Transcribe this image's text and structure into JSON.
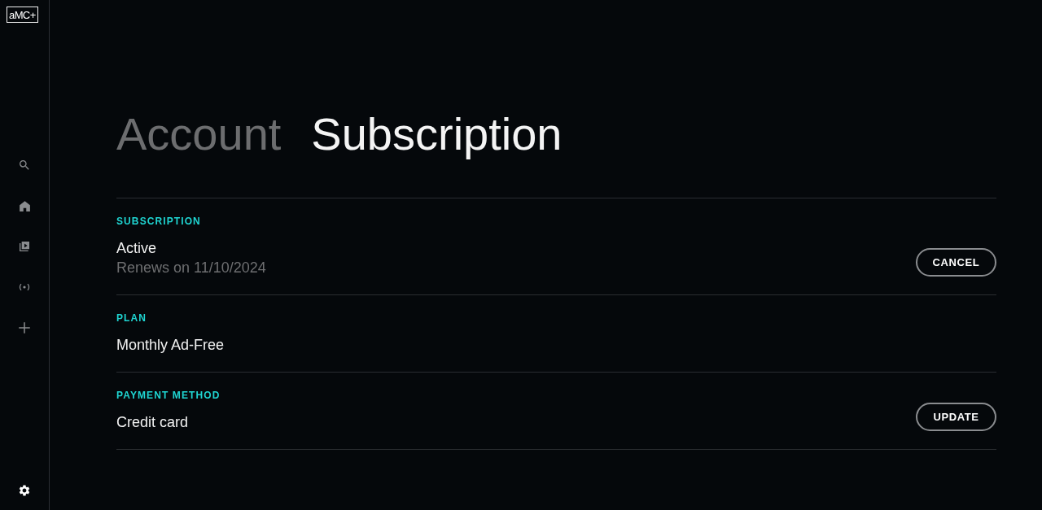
{
  "logo": {
    "text": "aMC+"
  },
  "sidebar": {
    "items": [
      {
        "kind": "search",
        "selected": false
      },
      {
        "kind": "home",
        "selected": false
      },
      {
        "kind": "library",
        "selected": false
      },
      {
        "kind": "live",
        "selected": false
      },
      {
        "kind": "add",
        "selected": false
      }
    ],
    "footer_item": {
      "kind": "settings",
      "selected": true
    }
  },
  "tabs": [
    {
      "label": "Account",
      "selected": false
    },
    {
      "label": "Subscription",
      "selected": true
    }
  ],
  "sections": [
    {
      "label": "SUBSCRIPTION",
      "value": "Active",
      "detail": "Renews on 11/10/2024",
      "button": "CANCEL"
    },
    {
      "label": "PLAN",
      "value": "Monthly Ad-Free"
    },
    {
      "label": "PAYMENT METHOD",
      "value": "Credit card",
      "button": "UPDATE"
    }
  ]
}
